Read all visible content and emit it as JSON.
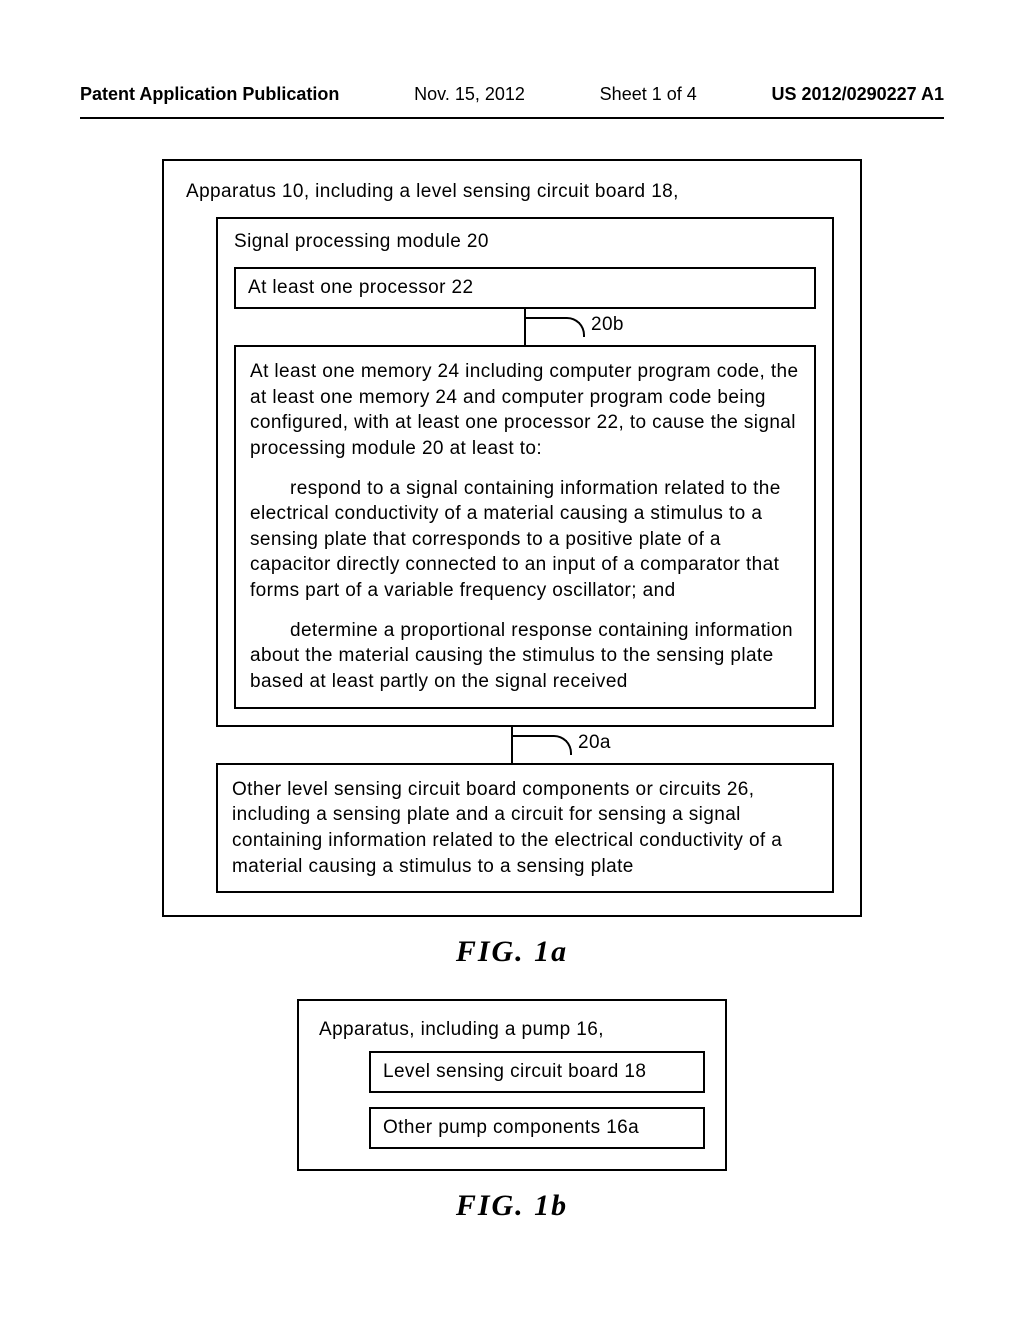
{
  "header": {
    "publication": "Patent Application Publication",
    "date": "Nov. 15, 2012",
    "sheet": "Sheet 1 of 4",
    "docnum": "US 2012/0290227 A1"
  },
  "fig1a": {
    "outer_title": "Apparatus 10, including a level sensing circuit board 18,",
    "module_title": "Signal processing module 20",
    "processor_box": "At least one processor 22",
    "conn_upper": "20b",
    "memory_para1": "At least one memory 24 including computer program code, the at least one memory 24 and computer program code being configured, with at least one processor 22, to cause the signal processing module 20 at least to:",
    "memory_para2": "respond to a signal containing information related to the electrical conductivity of a material causing a stimulus to a sensing plate that corresponds to a positive plate of a capacitor directly connected to an input of a comparator that forms part of a variable frequency oscillator; and",
    "memory_para3": "determine a proportional response containing information about the material causing the stimulus to the sensing plate based at least partly on the signal received",
    "conn_lower": "20a",
    "other_box": "Other level sensing circuit board components or circuits 26, including a sensing plate and a circuit for sensing a signal containing information related to the electrical conductivity of a material causing a stimulus to a sensing plate",
    "caption": "FIG.  1a"
  },
  "fig1b": {
    "outer_title": "Apparatus, including a pump 16,",
    "row1": "Level sensing circuit board 18",
    "row2": "Other pump components 16a",
    "caption": "FIG.  1b"
  }
}
